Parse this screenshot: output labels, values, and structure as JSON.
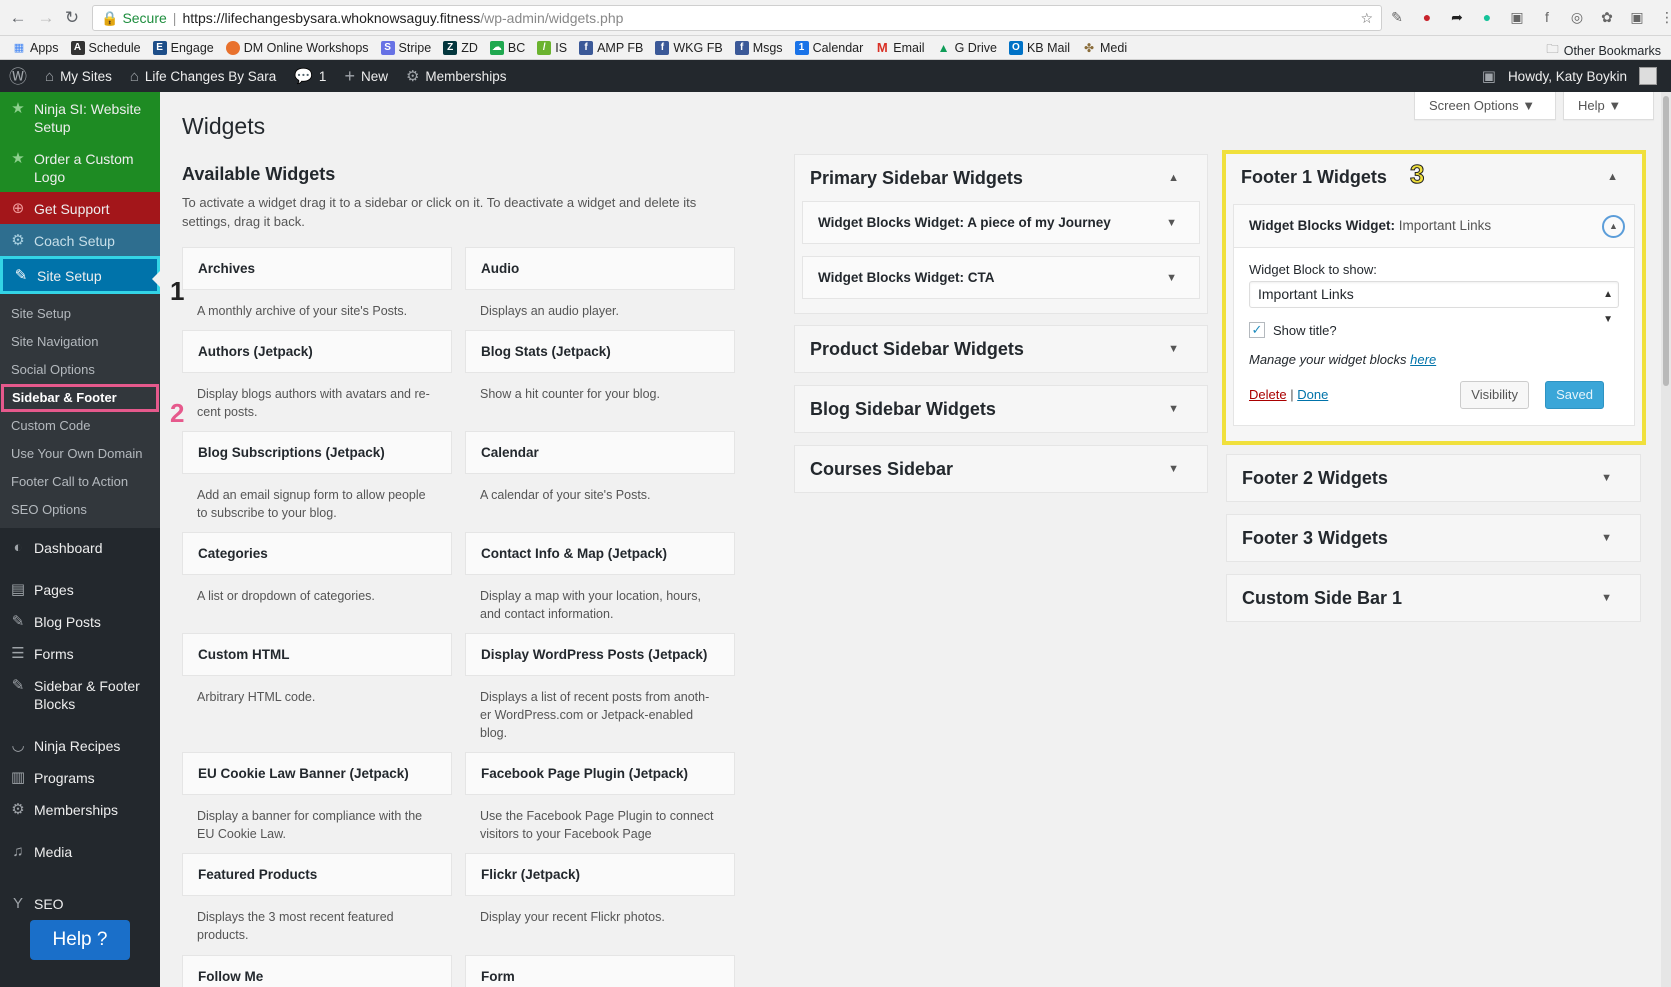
{
  "browser": {
    "secure_label": "Secure",
    "url_host": "https://lifechangesbysara.whoknowsaguy.fitness",
    "url_path": "/wp-admin/widgets.php",
    "bookmarks": [
      "Apps",
      "Schedule",
      "Engage",
      "DM Online Workshops",
      "Stripe",
      "ZD",
      "BC",
      "IS",
      "AMP FB",
      "WKG FB",
      "Msgs",
      "Calendar",
      "Email",
      "G Drive",
      "KB Mail",
      "Medi"
    ],
    "other_bookmarks": "Other Bookmarks"
  },
  "adminbar": {
    "my_sites": "My Sites",
    "site_name": "Life Changes By Sara",
    "comments_count": "1",
    "new": "New",
    "memberships": "Memberships",
    "howdy": "Howdy, Katy Boykin"
  },
  "sidebar": {
    "ninja_si": "Ninja SI: Website Setup",
    "order_logo": "Order a Custom Logo",
    "get_support": "Get Support",
    "coach_setup": "Coach Setup",
    "site_setup": "Site Setup",
    "sub": [
      "Site Setup",
      "Site Navigation",
      "Social Options",
      "Sidebar & Footer",
      "Custom Code",
      "Use Your Own Domain",
      "Footer Call to Action",
      "SEO Options"
    ],
    "dashboard": "Dashboard",
    "pages": "Pages",
    "blog_posts": "Blog Posts",
    "forms": "Forms",
    "sidebar_footer_blocks": "Sidebar & Footer Blocks",
    "ninja_recipes": "Ninja Recipes",
    "programs": "Programs",
    "memberships": "Memberships",
    "media": "Media",
    "seo": "SEO",
    "help_button": "Help ?"
  },
  "annotations": {
    "n1": "1",
    "n2": "2",
    "n3": "3"
  },
  "header": {
    "screen_options": "Screen Options ▼",
    "help": "Help ▼",
    "title": "Widgets"
  },
  "available": {
    "title": "Available Widgets",
    "desc": "To activate a widget drag it to a sidebar or click on it. To deactivate a widget and delete its settings, drag it back.",
    "widgets": [
      {
        "name": "Archives",
        "desc": "A monthly archive of your site's Posts."
      },
      {
        "name": "Audio",
        "desc": "Displays an audio player."
      },
      {
        "name": "Authors (Jetpack)",
        "desc": "Display blogs authors with avatars and re-cent posts."
      },
      {
        "name": "Blog Stats (Jetpack)",
        "desc": "Show a hit counter for your blog."
      },
      {
        "name": "Blog Subscriptions (Jetpack)",
        "desc": "Add an email signup form to allow people to subscribe to your blog."
      },
      {
        "name": "Calendar",
        "desc": "A calendar of your site's Posts."
      },
      {
        "name": "Categories",
        "desc": "A list or dropdown of categories."
      },
      {
        "name": "Contact Info & Map (Jetpack)",
        "desc": "Display a map with your location, hours, and contact information."
      },
      {
        "name": "Custom HTML",
        "desc": "Arbitrary HTML code."
      },
      {
        "name": "Display WordPress Posts (Jetpack)",
        "desc": "Displays a list of recent posts from anoth-er WordPress.com or Jetpack-enabled blog."
      },
      {
        "name": "EU Cookie Law Banner (Jetpack)",
        "desc": "Display a banner for compliance with the EU Cookie Law."
      },
      {
        "name": "Facebook Page Plugin (Jetpack)",
        "desc": "Use the Facebook Page Plugin to connect visitors to your Facebook Page"
      },
      {
        "name": "Featured Products",
        "desc": "Displays the 3 most recent featured products."
      },
      {
        "name": "Flickr (Jetpack)",
        "desc": "Display your recent Flickr photos."
      },
      {
        "name": "Follow Me",
        "desc": ""
      },
      {
        "name": "Form",
        "desc": ""
      }
    ]
  },
  "sidebars": {
    "primary": {
      "title": "Primary Sidebar Widgets",
      "widgets": [
        {
          "label": "Widget Blocks Widget: A piece of my Journey"
        },
        {
          "label": "Widget Blocks Widget: CTA"
        }
      ]
    },
    "product": {
      "title": "Product Sidebar Widgets"
    },
    "blog": {
      "title": "Blog Sidebar Widgets"
    },
    "courses": {
      "title": "Courses Sidebar"
    },
    "footer1": {
      "title": "Footer 1 Widgets",
      "widget_label": "Widget Blocks Widget:",
      "widget_sub": "Important Links",
      "field_label": "Widget Block to show:",
      "select_value": "Important Links",
      "show_title": "Show title?",
      "manage_text": "Manage your widget blocks",
      "manage_link": "here",
      "delete": "Delete",
      "done": "Done",
      "visibility": "Visibility",
      "saved": "Saved"
    },
    "footer2": {
      "title": "Footer 2 Widgets"
    },
    "footer3": {
      "title": "Footer 3 Widgets"
    },
    "custom1": {
      "title": "Custom Side Bar 1"
    }
  },
  "colors": {
    "accent": "#0073aa",
    "highlight_cyan": "#33d4e6",
    "highlight_pink": "#e6598c",
    "highlight_yellow": "#f0e03c"
  }
}
